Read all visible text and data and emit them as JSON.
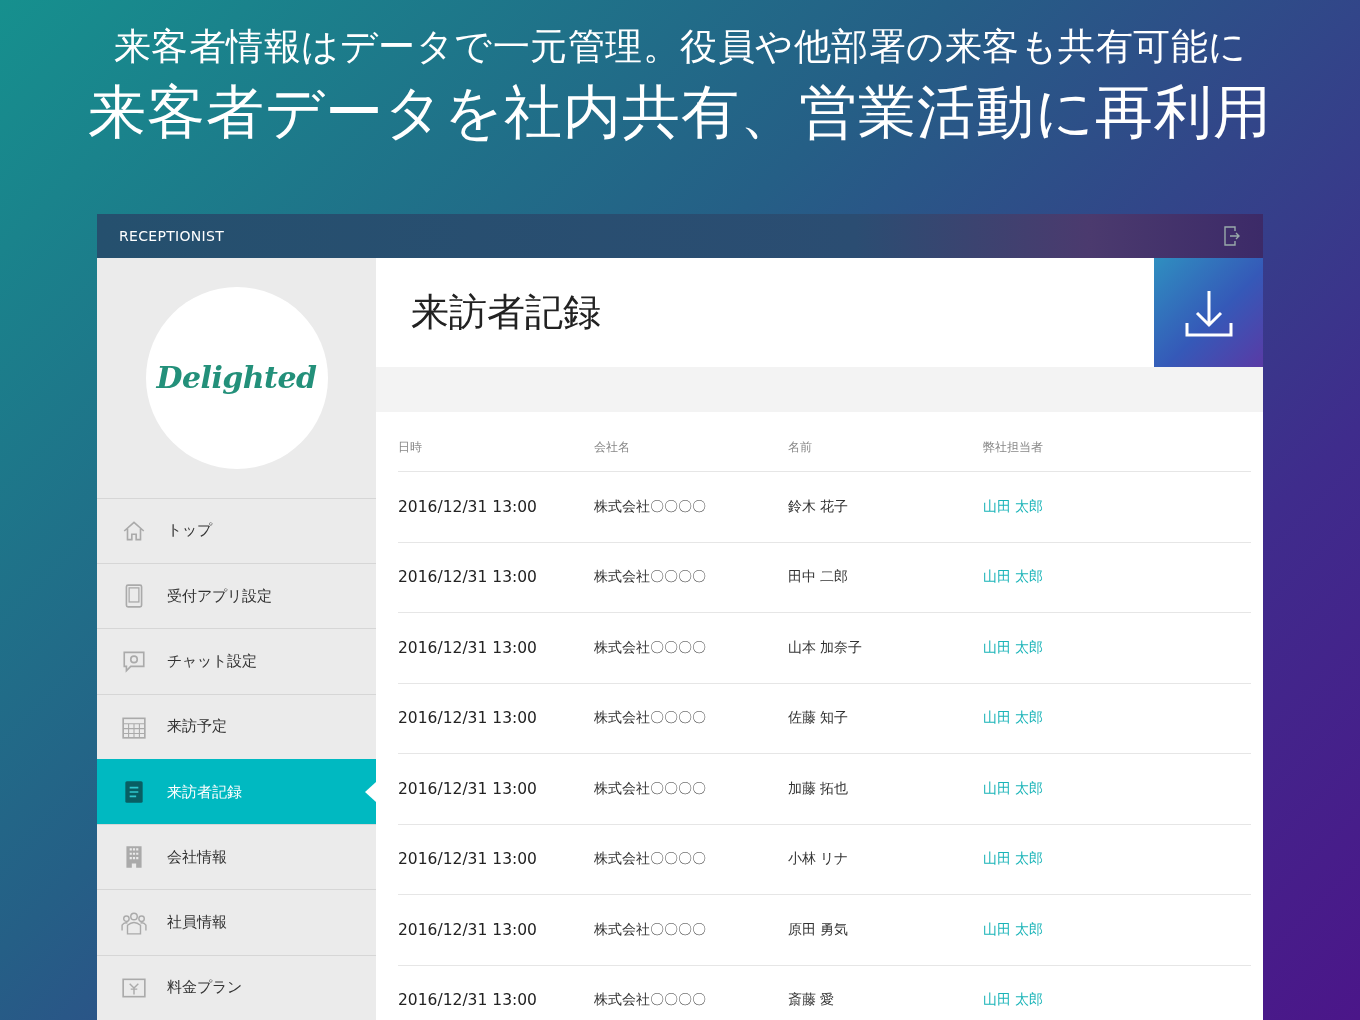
{
  "headline": {
    "subtitle": "来客者情報はデータで一元管理。役員や他部署の来客も共有可能に",
    "title": "来客者データを社内共有、営業活動に再利用"
  },
  "app": {
    "brand": "RECEPTIONIST",
    "logo": "Delighted",
    "page_title": "来訪者記録"
  },
  "sidebar": {
    "items": [
      {
        "label": "トップ",
        "selected": false
      },
      {
        "label": "受付アプリ設定",
        "selected": false
      },
      {
        "label": "チャット設定",
        "selected": false
      },
      {
        "label": "来訪予定",
        "selected": false
      },
      {
        "label": "来訪者記録",
        "selected": true
      },
      {
        "label": "会社情報",
        "selected": false
      },
      {
        "label": "社員情報",
        "selected": false
      },
      {
        "label": "料金プラン",
        "selected": false
      }
    ]
  },
  "table": {
    "columns": [
      "日時",
      "会社名",
      "名前",
      "弊社担当者"
    ],
    "rows": [
      [
        "2016/12/31 13:00",
        "株式会社〇〇〇〇",
        "鈴木 花子",
        "山田 太郎"
      ],
      [
        "2016/12/31 13:00",
        "株式会社〇〇〇〇",
        "田中 二郎",
        "山田 太郎"
      ],
      [
        "2016/12/31 13:00",
        "株式会社〇〇〇〇",
        "山本 加奈子",
        "山田 太郎"
      ],
      [
        "2016/12/31 13:00",
        "株式会社〇〇〇〇",
        "佐藤 知子",
        "山田 太郎"
      ],
      [
        "2016/12/31 13:00",
        "株式会社〇〇〇〇",
        "加藤 拓也",
        "山田 太郎"
      ],
      [
        "2016/12/31 13:00",
        "株式会社〇〇〇〇",
        "小林 リナ",
        "山田 太郎"
      ],
      [
        "2016/12/31 13:00",
        "株式会社〇〇〇〇",
        "原田 勇気",
        "山田 太郎"
      ],
      [
        "2016/12/31 13:00",
        "株式会社〇〇〇〇",
        "斎藤 愛",
        "山田 太郎"
      ]
    ]
  }
}
